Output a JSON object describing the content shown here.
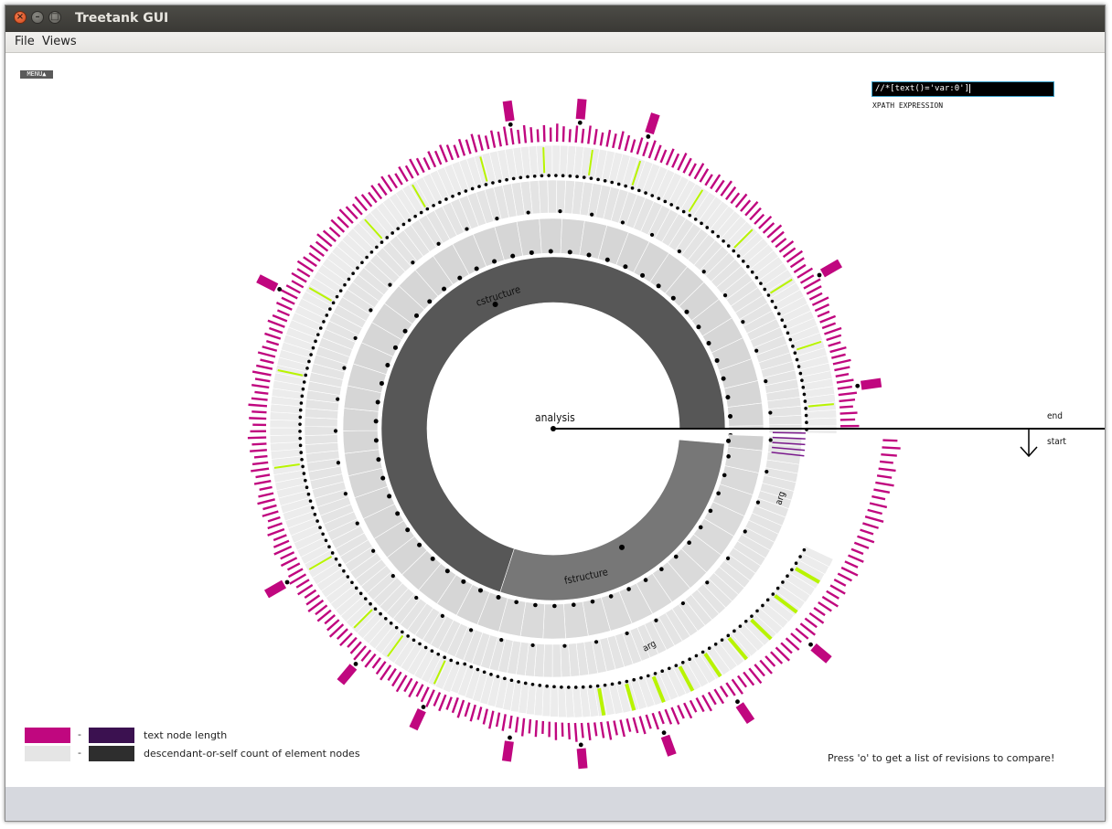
{
  "window": {
    "title": "Treetank GUI"
  },
  "titlebar": {
    "close_symbol": "×",
    "min_symbol": "–",
    "max_symbol": "□"
  },
  "menubar": {
    "items": [
      {
        "label": "File"
      },
      {
        "label": "Views"
      }
    ]
  },
  "canvas": {
    "menu_toggle": "MENU▲",
    "xpath": {
      "value": "//*[text()='var:0']",
      "label": "XPATH EXPRESSION"
    },
    "labels": {
      "root": "analysis",
      "cstructure": "cstructure",
      "fstructure": "fstructure",
      "arg1": "arg",
      "arg2": "arg",
      "end": "end",
      "start": "start"
    },
    "hint": "Press 'o' to get a list of revisions to compare!"
  },
  "legend": [
    {
      "from_color": "#c0077f",
      "to_color": "#3b1150",
      "text": "text node length"
    },
    {
      "from_color": "#e5e5e5",
      "to_color": "#2e2e2e",
      "text": "descendant-or-self count of element nodes"
    }
  ],
  "colors": {
    "magenta": "#c0077f",
    "highlight": "#b8f400",
    "inner_dark": "#575757",
    "inner_mid": "#777777",
    "ring_light": "#d6d6d6"
  }
}
